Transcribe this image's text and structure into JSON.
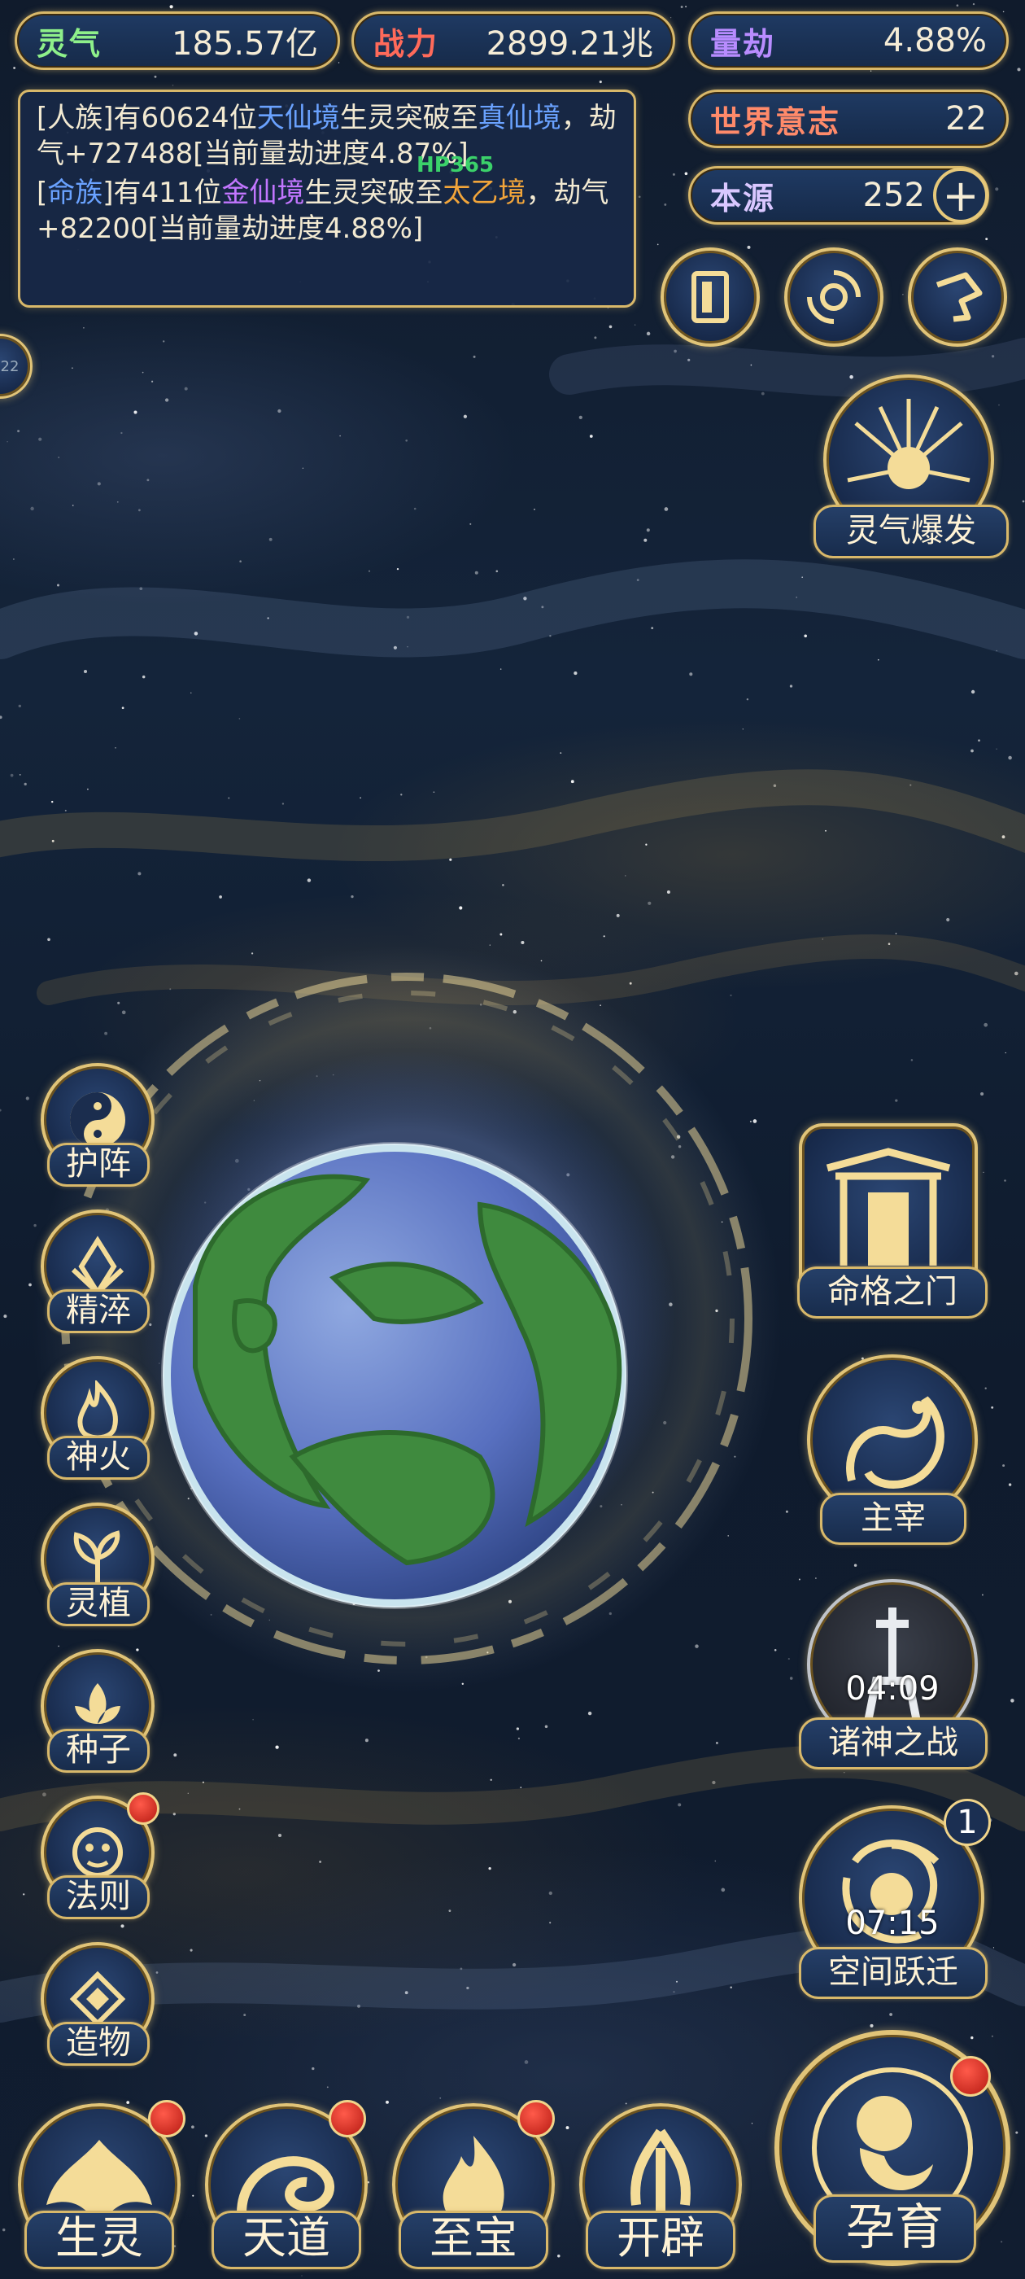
{
  "stats": {
    "lingqi": {
      "label": "灵气",
      "value": "185.57亿"
    },
    "zhanli": {
      "label": "战力",
      "value": "2899.21兆"
    },
    "liangjie": {
      "label": "量劫",
      "value": "4.88%"
    },
    "shijie": {
      "label": "世界意志",
      "value": "22"
    },
    "benyuan": {
      "label": "本源",
      "value": "252"
    }
  },
  "log": {
    "line1": {
      "a": "[人族]有60624位",
      "b": "天仙境",
      "c": "生灵突破至",
      "d": "真仙境",
      "e": "，劫气+727488[当前量劫进度4.87%]"
    },
    "line2": {
      "a": "[",
      "b": "命族",
      "c": "]有411位",
      "d": "金仙境",
      "e": "生灵突破至",
      "f": "太乙境",
      "g": "，劫气+82200[当前量劫进度4.88%]"
    },
    "overlay": "HP365"
  },
  "side_edge_label": "22",
  "right_buttons": {
    "burst": "灵气爆发",
    "mingge": "命格之门",
    "zhuzai": "主宰",
    "zhushen": {
      "label": "诸神之战",
      "timer": "04:09"
    },
    "kongjian": {
      "label": "空间跃迁",
      "timer": "07:15",
      "badge": "1"
    }
  },
  "left_buttons": [
    "护阵",
    "精淬",
    "神火",
    "灵植",
    "种子",
    "法则",
    "造物"
  ],
  "bottom_nav": [
    "生灵",
    "天道",
    "至宝",
    "开辟"
  ],
  "main_button": "孕育",
  "colors": {
    "gold": "#d8b86a",
    "panel": "#182846",
    "red_dot": "#c8281c",
    "blue_text": "#6aa2ff",
    "purple_text": "#c276ff",
    "orange_text": "#f2a53a"
  }
}
